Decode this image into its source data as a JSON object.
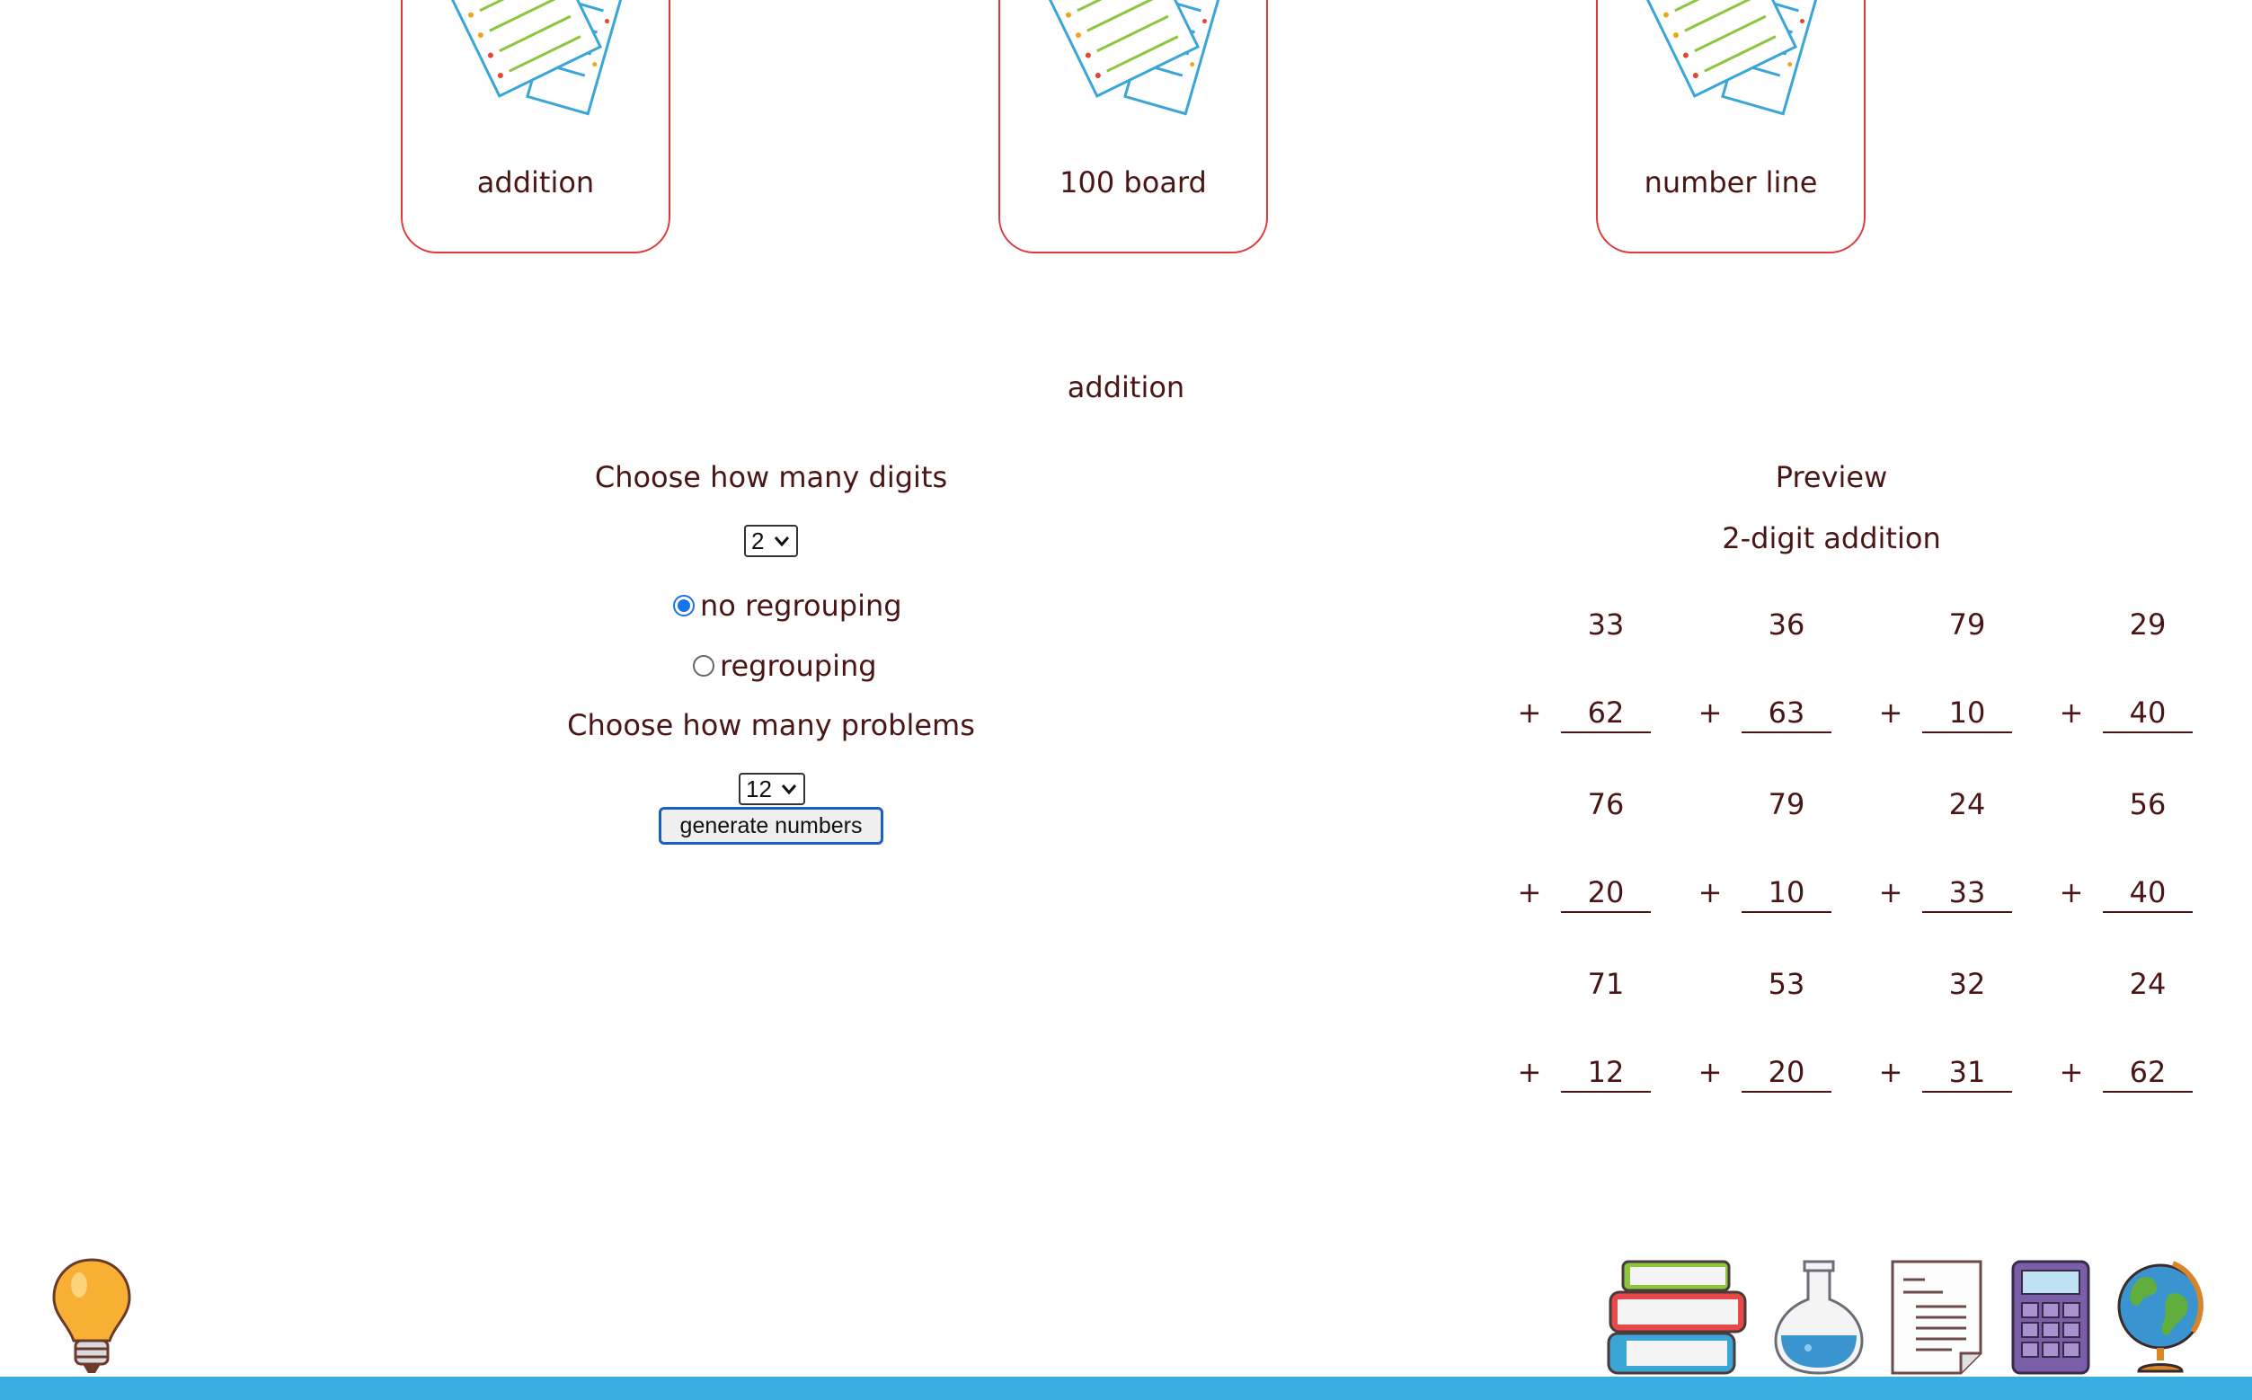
{
  "cards": [
    {
      "label": "addition",
      "icon": "worksheet-icon"
    },
    {
      "label": "100 board",
      "icon": "worksheet-icon"
    },
    {
      "label": "number line",
      "icon": "worksheet-icon"
    }
  ],
  "section_title": "addition",
  "controls": {
    "digits_label": "Choose how many digits",
    "digits_value": "2",
    "options": [
      {
        "label": "no regrouping",
        "checked": true
      },
      {
        "label": "regrouping",
        "checked": false
      }
    ],
    "problems_label": "Choose how many problems",
    "problems_value": "12",
    "generate_label": "generate numbers"
  },
  "preview": {
    "title": "Preview",
    "subtitle": "2-digit addition",
    "operator": "+",
    "problems": [
      {
        "top": "33",
        "bottom": "62"
      },
      {
        "top": "36",
        "bottom": "63"
      },
      {
        "top": "79",
        "bottom": "10"
      },
      {
        "top": "29",
        "bottom": "40"
      },
      {
        "top": "76",
        "bottom": "20"
      },
      {
        "top": "79",
        "bottom": "10"
      },
      {
        "top": "24",
        "bottom": "33"
      },
      {
        "top": "56",
        "bottom": "40"
      },
      {
        "top": "71",
        "bottom": "12"
      },
      {
        "top": "53",
        "bottom": "20"
      },
      {
        "top": "32",
        "bottom": "31"
      },
      {
        "top": "24",
        "bottom": "62"
      }
    ]
  },
  "bottom_icons": [
    "lightbulb-icon",
    "books-icon",
    "flask-icon",
    "document-icon",
    "calculator-icon",
    "globe-icon"
  ],
  "colors": {
    "accent": "#e03a3a",
    "footer": "#3aade0",
    "text": "#4a1515",
    "radio": "#1a73e8"
  }
}
